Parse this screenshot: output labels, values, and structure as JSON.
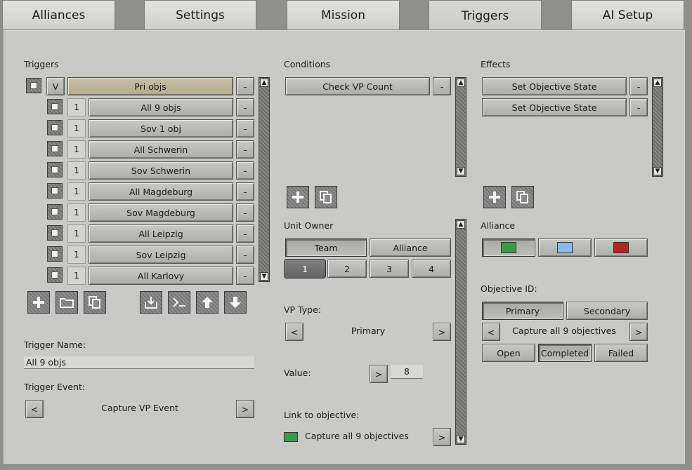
{
  "tabs": [
    {
      "label": "Alliances"
    },
    {
      "label": "Settings"
    },
    {
      "label": "Mission"
    },
    {
      "label": "Triggers"
    },
    {
      "label": "AI Setup"
    }
  ],
  "triggers": {
    "heading": "Triggers",
    "parent": {
      "toggle": "V",
      "label": "Pri objs",
      "remove": "-"
    },
    "rows": [
      {
        "count": "1",
        "label": "All 9 objs",
        "remove": "-"
      },
      {
        "count": "1",
        "label": "Sov 1 obj",
        "remove": "-"
      },
      {
        "count": "1",
        "label": "All Schwerin",
        "remove": "-"
      },
      {
        "count": "1",
        "label": "Sov Schwerin",
        "remove": "-"
      },
      {
        "count": "1",
        "label": "All Magdeburg",
        "remove": "-"
      },
      {
        "count": "1",
        "label": "Sov Magdeburg",
        "remove": "-"
      },
      {
        "count": "1",
        "label": "All Leipzig",
        "remove": "-"
      },
      {
        "count": "1",
        "label": "Sov Leipzig",
        "remove": "-"
      },
      {
        "count": "1",
        "label": "All Karlovy",
        "remove": "-"
      }
    ],
    "icons": [
      "plus-icon",
      "folder-icon",
      "copy-icon",
      "import-icon",
      "console-icon",
      "arrow-up-icon",
      "arrow-down-icon"
    ],
    "name_label": "Trigger Name:",
    "name_value": "All 9 objs",
    "event_label": "Trigger Event:",
    "event_value": "Capture VP Event",
    "prev": "<",
    "next": ">"
  },
  "conditions": {
    "heading": "Conditions",
    "items": [
      {
        "label": "Check VP Count",
        "remove": "-"
      }
    ],
    "unit_owner_label": "Unit Owner",
    "owner_team": "Team",
    "owner_alliance": "Alliance",
    "teams": [
      "1",
      "2",
      "3",
      "4"
    ],
    "vp_type_label": "VP Type:",
    "vp_type_value": "Primary",
    "value_label": "Value:",
    "value_btn": ">",
    "value": "8",
    "link_label": "Link to objective:",
    "link_value": "Capture all 9 objectives",
    "link_btn": ">",
    "prev": "<",
    "next": ">"
  },
  "effects": {
    "heading": "Effects",
    "items": [
      {
        "label": "Set Objective State",
        "remove": "-"
      },
      {
        "label": "Set Objective State",
        "remove": "-"
      }
    ],
    "alliance_label": "Alliance",
    "alliance_colors": [
      "#3a9a4a",
      "#8fb8ee",
      "#b82424"
    ],
    "objective_id_label": "Objective ID:",
    "primary": "Primary",
    "secondary": "Secondary",
    "objective_value": "Capture all 9 objectives",
    "states": [
      "Open",
      "Completed",
      "Failed"
    ],
    "prev": "<",
    "next": ">"
  },
  "colors": {
    "link_swatch": "#3a9a4a"
  }
}
